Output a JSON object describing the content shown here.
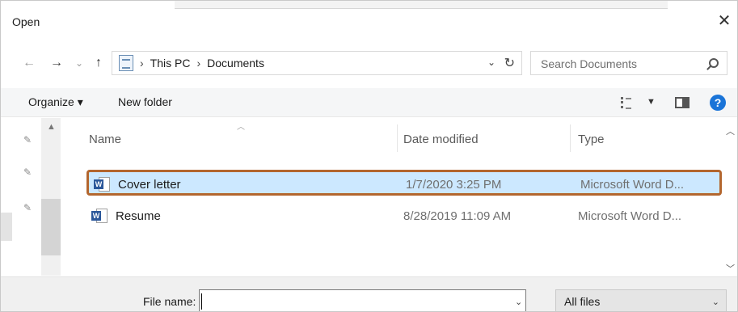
{
  "window": {
    "title": "Open",
    "close_glyph": "✕"
  },
  "nav": {
    "back_glyph": "←",
    "forward_glyph": "→",
    "recent_glyph": "⌄",
    "up_glyph": "↑",
    "breadcrumb": [
      "This PC",
      "Documents"
    ],
    "breadcrumb_sep": "›",
    "dropdown_glyph": "⌄",
    "refresh_glyph": "↻",
    "search_placeholder": "Search Documents"
  },
  "toolbar": {
    "organize_label": "Organize ▾",
    "new_folder_label": "New folder",
    "view_drop_glyph": "▼",
    "help_glyph": "?"
  },
  "columns": {
    "name": "Name",
    "date": "Date modified",
    "type": "Type"
  },
  "files": [
    {
      "name": "Cover letter",
      "date": "1/7/2020 3:25 PM",
      "type": "Microsoft Word D...",
      "selected": true
    },
    {
      "name": "Resume",
      "date": "8/28/2019 11:09 AM",
      "type": "Microsoft Word D...",
      "selected": false
    }
  ],
  "icons": {
    "pin": "pin-icon",
    "word_letter": "W"
  },
  "bottom": {
    "file_name_label": "File name:",
    "file_name_value": "",
    "filter_value": "All files",
    "dropdown_glyph": "⌄"
  },
  "colors": {
    "selection_bg": "#cce8ff",
    "highlight_border": "#b3662e",
    "help_blue": "#1a74d8",
    "word_blue": "#2b579a"
  }
}
